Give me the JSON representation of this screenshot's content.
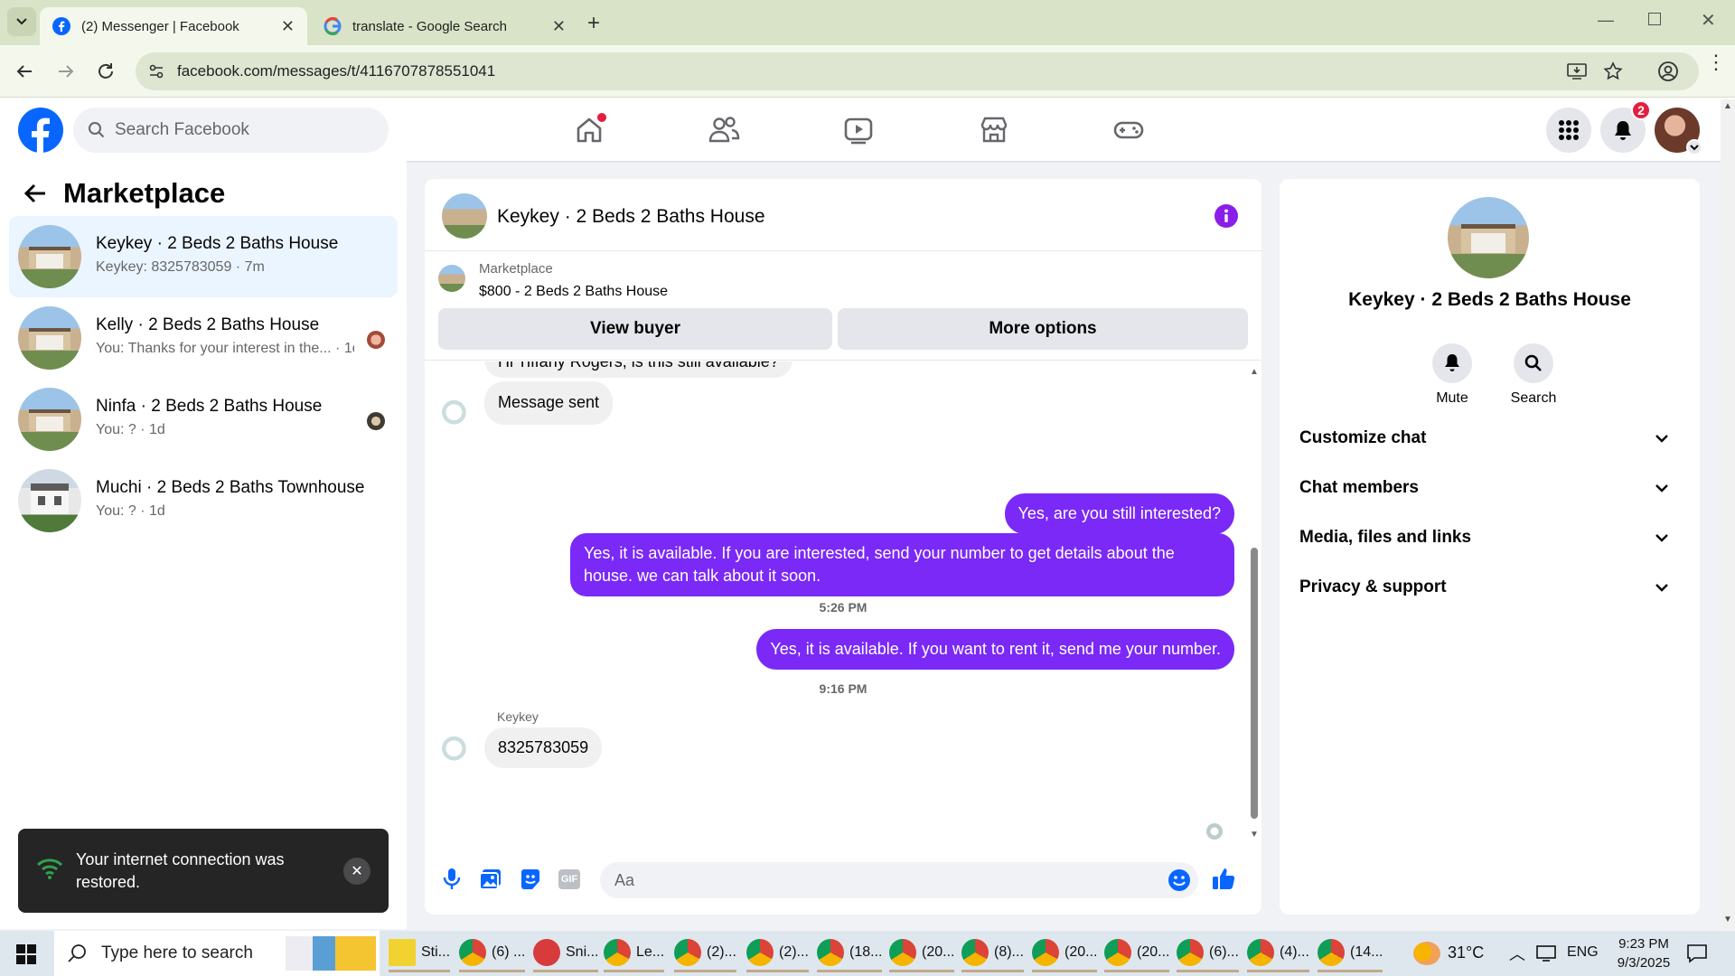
{
  "browser": {
    "tabs": [
      {
        "title": "(2) Messenger | Facebook"
      },
      {
        "title": "translate - Google Search"
      }
    ],
    "url": "facebook.com/messages/t/4116707878551041"
  },
  "fb_header": {
    "search_placeholder": "Search Facebook",
    "notification_count": "2"
  },
  "sidebar": {
    "title": "Marketplace",
    "conversations": [
      {
        "name": "Keykey · 2 Beds 2 Baths House",
        "preview": "Keykey: 8325783059 · 7m"
      },
      {
        "name": "Kelly · 2 Beds 2 Baths House",
        "preview": "You: Thanks for your interest in the... · 1d"
      },
      {
        "name": "Ninfa · 2 Beds 2 Baths House",
        "preview": "You: ? · 1d"
      },
      {
        "name": "Muchi · 2 Beds 2 Baths Townhouse",
        "preview": "You: ? · 1d"
      }
    ]
  },
  "chat": {
    "title": "Keykey · 2 Beds 2 Baths House",
    "listing_source": "Marketplace",
    "listing_title": "$800 - 2 Beds 2 Baths House",
    "view_buyer_label": "View buyer",
    "more_options_label": "More options",
    "messages": {
      "cut_incoming": "Hi Tiffany Rogers, is this still available?",
      "message_sent": "Message sent",
      "out1": "Yes, are you still interested?",
      "out2": "Yes, it is available. If you are interested, send your number to get details about the house. we can talk about it soon.",
      "time1": "5:26 PM",
      "out3": "Yes, it is available. If you want to rent it, send me your number.",
      "time2": "9:16 PM",
      "sender_name": "Keykey",
      "in_last": "8325783059"
    },
    "composer_placeholder": "Aa"
  },
  "info_panel": {
    "name": "Keykey · 2 Beds 2 Baths House",
    "mute_label": "Mute",
    "search_label": "Search",
    "sections": [
      "Customize chat",
      "Chat members",
      "Media, files and links",
      "Privacy & support"
    ]
  },
  "toast": {
    "message": "Your internet connection was restored."
  },
  "taskbar": {
    "search_placeholder": "Type here to search",
    "items": [
      "Sti...",
      "(6) ...",
      "Sni...",
      "Le...",
      "(2)...",
      "(2)...",
      "(18...",
      "(20...",
      "(8)...",
      "(20...",
      "(20...",
      "(6)...",
      "(4)...",
      "(14..."
    ],
    "temperature": "31°C",
    "language": "ENG",
    "time": "9:23 PM",
    "date": "9/3/2025"
  },
  "colors": {
    "fb_blue": "#0866ff",
    "messenger_purple": "#7a29f7",
    "notification_red": "#e41e3f"
  }
}
